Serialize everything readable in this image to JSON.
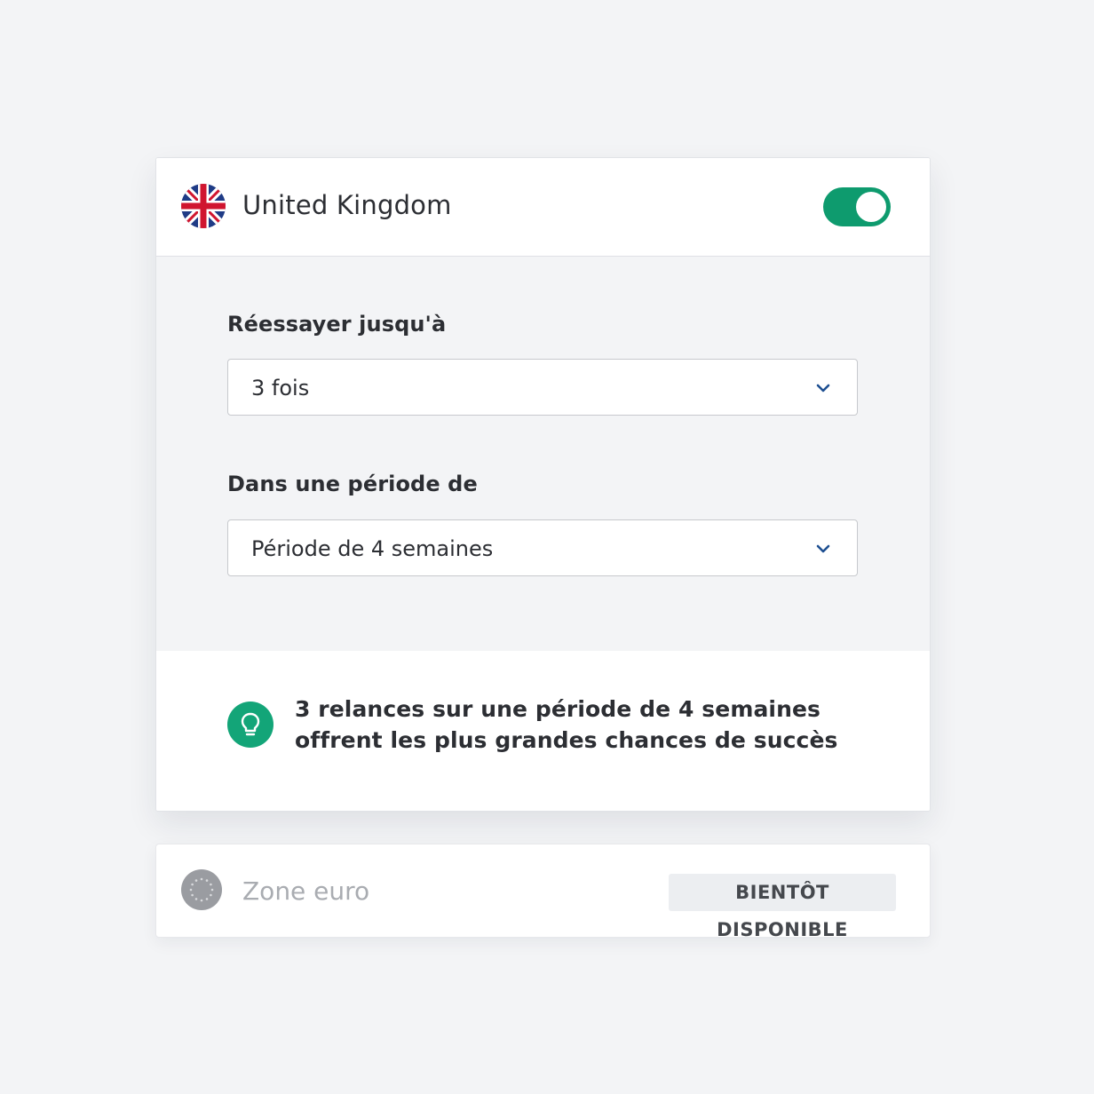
{
  "primary_country": {
    "title": "United Kingdom",
    "flag_icon": "uk-flag-icon",
    "enabled": true,
    "toggle_color": "#0e9b6e"
  },
  "settings": {
    "retry_label": "Réessayer jusqu'à",
    "retry_value": "3 fois",
    "period_label": "Dans une période de",
    "period_value": "Période de 4 semaines"
  },
  "tip": {
    "icon": "lightbulb-icon",
    "line1": "3 relances sur une période de 4 semaines",
    "line2": "offrent les plus grandes chances de succès",
    "icon_color": "#13a578"
  },
  "secondary_country": {
    "title": "Zone euro",
    "flag_icon": "eu-flag-icon",
    "badge": "BIENTÔT DISPONIBLE"
  }
}
